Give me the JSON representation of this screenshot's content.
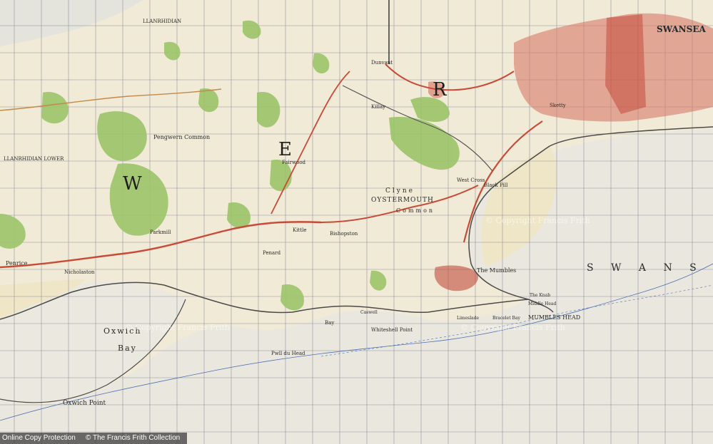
{
  "map": {
    "labels": {
      "swansea_town": "SWANSEA",
      "swansea_bay": "S W A N S",
      "oxwich_1": "Oxwich",
      "oxwich_2": "Bay",
      "oxwich_point": "Oxwich Point",
      "mumbles_head": "MUMBLES HEAD",
      "the_mumbles": "The Mumbles",
      "oystermouth": "OYSTERMOUTH",
      "clyne": "Clyne",
      "common": "Common",
      "pwll_du_head": "Pwll du Head",
      "whiteshell_point": "Whiteshell Point",
      "nicholaston": "Nicholaston",
      "penrice": "Penrice",
      "penard": "Penard",
      "llanrhidian": "LLANRHIDIAN",
      "llanrhidian_lower": "LLANRHIDIAN LOWER",
      "kittle": "Kittle",
      "bishopston": "Bishopston",
      "black_pill": "Black Pill",
      "sketty": "Sketty",
      "west_cross": "West Cross",
      "killay": "Killay",
      "dunvant": "Dunvant",
      "fairwood": "Fairwood",
      "pengwern_common": "Pengwern Common",
      "parkmill": "Parkmill",
      "bracelet_bay": "Bracelet Bay",
      "limeslade": "Limeslade",
      "caswell": "Caswell",
      "pwlldu_bay": "Bay",
      "letter_w": "W",
      "letter_e": "E",
      "letter_r": "R",
      "middle_head": "Middle Head",
      "the_knab": "The Knab"
    },
    "watermarks": [
      "© Copyright Francis Frith",
      "© Copyright Francis Frith",
      "© Copyright Francis Frith"
    ]
  },
  "footer": {
    "left": "Online Copy Protection",
    "right": "© The Francis Frith Collection"
  }
}
